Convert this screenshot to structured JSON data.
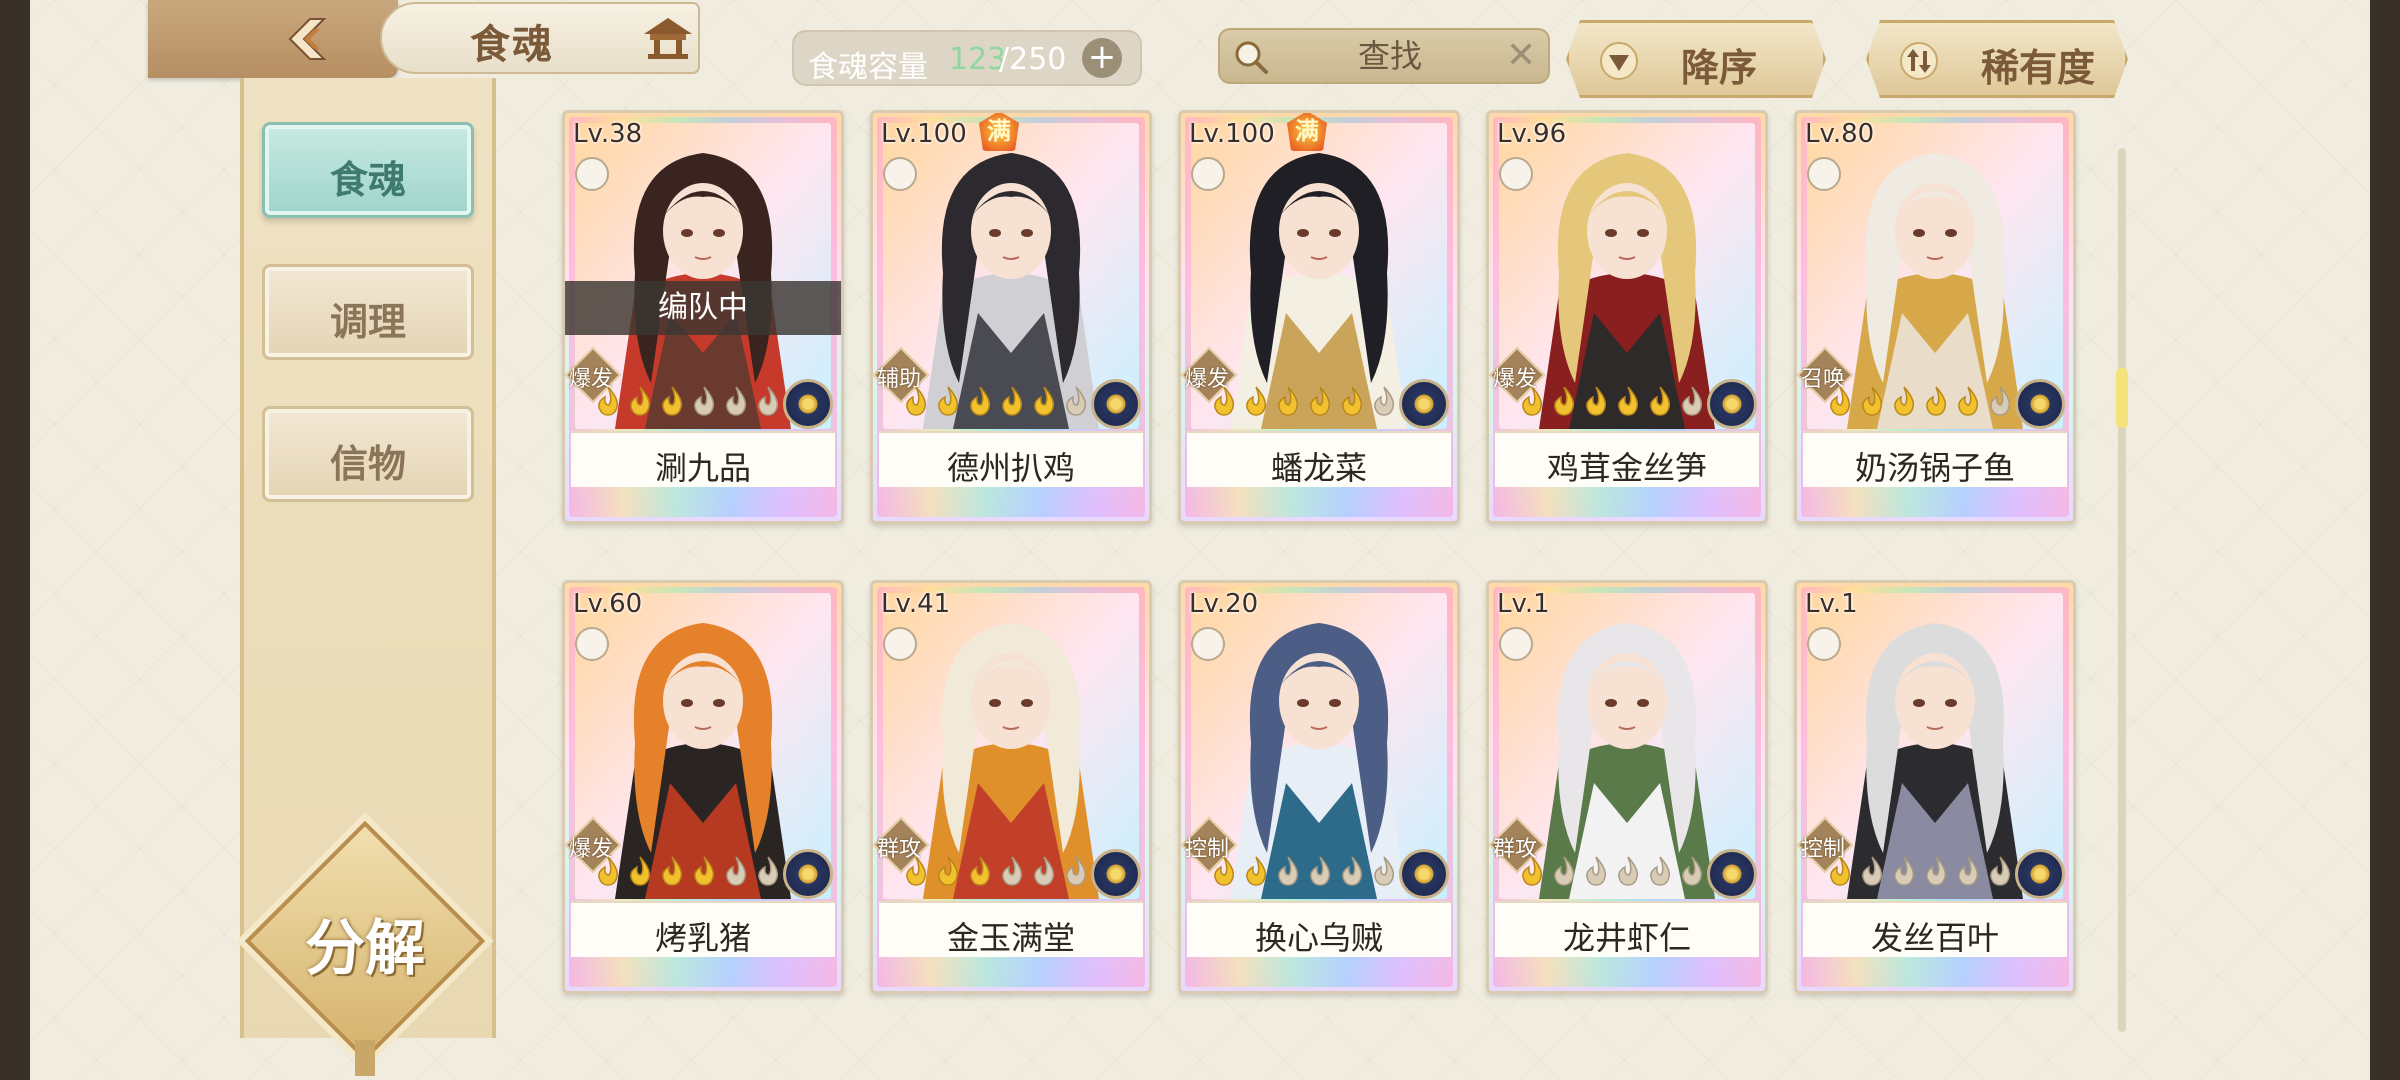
{
  "header": {
    "title": "食魂",
    "capacity_label": "食魂容量",
    "capacity_current": "123",
    "capacity_max": "/250",
    "search_placeholder": "查找",
    "sort_order_label": "降序",
    "sort_by_label": "稀有度"
  },
  "sidebar": {
    "items": [
      {
        "label": "食魂",
        "active": true
      },
      {
        "label": "调理",
        "active": false
      },
      {
        "label": "信物",
        "active": false
      }
    ],
    "decompose_label": "分解"
  },
  "cards": [
    {
      "level": "Lv.38",
      "name": "涮九品",
      "role": "爆发",
      "stars": 3,
      "full": false,
      "team": "编队中",
      "palette": [
        "#3a2420",
        "#c53a2a",
        "#6a3a2e"
      ]
    },
    {
      "level": "Lv.100",
      "name": "德州扒鸡",
      "role": "辅助",
      "stars": 5,
      "full": true,
      "team": "",
      "palette": [
        "#2c2a2e",
        "#cfcfd4",
        "#4a4a52"
      ]
    },
    {
      "level": "Lv.100",
      "name": "蟠龙菜",
      "role": "爆发",
      "stars": 5,
      "full": true,
      "team": "",
      "palette": [
        "#1f1f25",
        "#f4efe3",
        "#c9a45a"
      ]
    },
    {
      "level": "Lv.96",
      "name": "鸡茸金丝笋",
      "role": "爆发",
      "stars": 5,
      "full": false,
      "team": "",
      "palette": [
        "#e4c77a",
        "#8a1f1f",
        "#2e2a2a"
      ]
    },
    {
      "level": "Lv.80",
      "name": "奶汤锅子鱼",
      "role": "召唤",
      "stars": 5,
      "full": false,
      "team": "",
      "palette": [
        "#efeae2",
        "#d7a84a",
        "#e9dcc9"
      ]
    },
    {
      "level": "Lv.60",
      "name": "烤乳猪",
      "role": "爆发",
      "stars": 4,
      "full": false,
      "team": "",
      "palette": [
        "#e4812a",
        "#2a2422",
        "#b63a22"
      ]
    },
    {
      "level": "Lv.41",
      "name": "金玉满堂",
      "role": "群攻",
      "stars": 3,
      "full": false,
      "team": "",
      "palette": [
        "#f2ead9",
        "#e0902a",
        "#c2402a"
      ]
    },
    {
      "level": "Lv.20",
      "name": "换心乌贼",
      "role": "控制",
      "stars": 2,
      "full": false,
      "team": "",
      "palette": [
        "#4c5e85",
        "#e8eef5",
        "#2e6b8a"
      ]
    },
    {
      "level": "Lv.1",
      "name": "龙井虾仁",
      "role": "群攻",
      "stars": 1,
      "full": false,
      "team": "",
      "palette": [
        "#e9e6ea",
        "#5a7a4a",
        "#f2f2f2"
      ]
    },
    {
      "level": "Lv.1",
      "name": "发丝百叶",
      "role": "控制",
      "stars": 1,
      "full": false,
      "team": "",
      "palette": [
        "#dcdcdc",
        "#2c2c30",
        "#8a8aa0"
      ]
    }
  ]
}
